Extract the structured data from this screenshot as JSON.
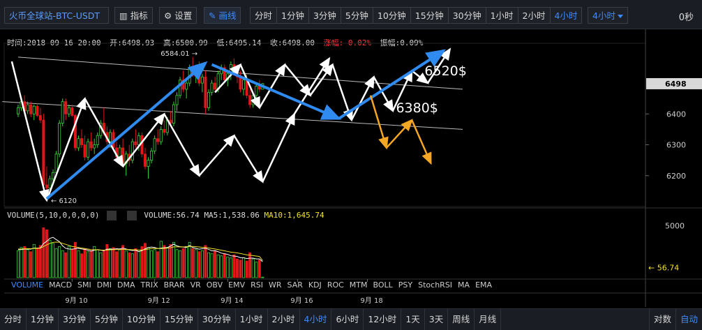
{
  "toolbar": {
    "symbol": "火币全球站-BTC-USDT",
    "indicator_label": "指标",
    "settings_label": "设置",
    "draw_label": "画线",
    "intervals": [
      "分时",
      "1分钟",
      "3分钟",
      "5分钟",
      "10分钟",
      "15分钟",
      "30分钟",
      "1小时",
      "2小时",
      "4小时"
    ],
    "selected_interval": "4小时",
    "dropdown_label": "4小时",
    "countdown": "0秒"
  },
  "ohlc": {
    "time": "时间:2018-09-16 20:00",
    "open": "开:6498.93",
    "high": "高:6500.99",
    "low": "低:6495.14",
    "close": "收:6498.00",
    "change": "涨幅:-0.02%",
    "amplitude": "振幅:0.09%"
  },
  "volume_info": {
    "params": "VOLUME(5,10,0,0,0,0)",
    "volume": "VOLUME:56.74",
    "ma5": "MA5:1,538.06",
    "ma10": "MA10:1,645.74"
  },
  "indicators": [
    "VOLUME",
    "MACD",
    "SMI",
    "DMI",
    "DMA",
    "TRIX",
    "BRAR",
    "VR",
    "OBV",
    "EMV",
    "RSI",
    "WR",
    "SAR",
    "KDJ",
    "ROC",
    "MTM",
    "BOLL",
    "PSY",
    "StochRSI",
    "MA",
    "EMA"
  ],
  "bottom": {
    "periods": [
      "分时",
      "1分钟",
      "3分钟",
      "5分钟",
      "10分钟",
      "15分钟",
      "30分钟",
      "1小时",
      "2小时",
      "4小时",
      "6小时",
      "12小时",
      "1天",
      "3天",
      "周线",
      "月线"
    ],
    "selected": "4小时",
    "log_label": "对数",
    "auto_label": "自动"
  },
  "colors": {
    "up": "#3ad23a",
    "down": "#e0161b",
    "blue_arrow": "#2f8bf0",
    "orange": "#f5a623",
    "ma10": "#f3e12a"
  },
  "chart_data": {
    "type": "candlestick",
    "price_ticks": [
      6200,
      6300,
      6400
    ],
    "current_price_label": "6498",
    "volume_tick": "5000",
    "last_volume_label": "56.74",
    "x_ticks": [
      {
        "label": "9月 10",
        "index": 17
      },
      {
        "label": "9月 12",
        "index": 43
      },
      {
        "label": "9月 14",
        "index": 66
      },
      {
        "label": "9月 16",
        "index": 88
      },
      {
        "label": "9月 18",
        "index": 110
      }
    ],
    "annotations": {
      "high_label": "6584.01",
      "low_label": "6120",
      "target_up": "6520$",
      "target_down": "6380$"
    },
    "ohlc": [
      [
        6400,
        6430,
        6390,
        6420
      ],
      [
        6420,
        6450,
        6410,
        6440
      ],
      [
        6440,
        6460,
        6400,
        6410
      ],
      [
        6410,
        6440,
        6400,
        6430
      ],
      [
        6430,
        6440,
        6390,
        6400
      ],
      [
        6400,
        6430,
        6380,
        6425
      ],
      [
        6425,
        6435,
        6390,
        6395
      ],
      [
        6395,
        6420,
        6370,
        6380
      ],
      [
        6380,
        6400,
        6150,
        6170
      ],
      [
        6170,
        6230,
        6120,
        6160
      ],
      [
        6160,
        6200,
        6130,
        6190
      ],
      [
        6190,
        6220,
        6170,
        6210
      ],
      [
        6210,
        6280,
        6200,
        6270
      ],
      [
        6270,
        6380,
        6260,
        6370
      ],
      [
        6370,
        6450,
        6360,
        6440
      ],
      [
        6440,
        6450,
        6380,
        6400
      ],
      [
        6400,
        6430,
        6390,
        6420
      ],
      [
        6420,
        6430,
        6390,
        6395
      ],
      [
        6395,
        6400,
        6280,
        6290
      ],
      [
        6290,
        6330,
        6280,
        6320
      ],
      [
        6320,
        6350,
        6290,
        6300
      ],
      [
        6300,
        6330,
        6250,
        6260
      ],
      [
        6260,
        6320,
        6250,
        6310
      ],
      [
        6310,
        6340,
        6280,
        6290
      ],
      [
        6290,
        6320,
        6270,
        6300
      ],
      [
        6300,
        6340,
        6290,
        6330
      ],
      [
        6330,
        6380,
        6320,
        6370
      ],
      [
        6370,
        6420,
        6330,
        6340
      ],
      [
        6340,
        6360,
        6300,
        6310
      ],
      [
        6310,
        6350,
        6290,
        6340
      ],
      [
        6340,
        6350,
        6280,
        6290
      ],
      [
        6290,
        6310,
        6250,
        6260
      ],
      [
        6260,
        6300,
        6240,
        6290
      ],
      [
        6290,
        6320,
        6230,
        6240
      ],
      [
        6240,
        6280,
        6200,
        6270
      ],
      [
        6270,
        6300,
        6230,
        6250
      ],
      [
        6250,
        6320,
        6240,
        6310
      ],
      [
        6310,
        6350,
        6290,
        6300
      ],
      [
        6300,
        6340,
        6280,
        6330
      ],
      [
        6330,
        6340,
        6260,
        6270
      ],
      [
        6270,
        6290,
        6220,
        6230
      ],
      [
        6230,
        6260,
        6190,
        6250
      ],
      [
        6250,
        6290,
        6240,
        6280
      ],
      [
        6280,
        6330,
        6270,
        6320
      ],
      [
        6320,
        6350,
        6300,
        6310
      ],
      [
        6310,
        6360,
        6300,
        6350
      ],
      [
        6350,
        6380,
        6330,
        6340
      ],
      [
        6340,
        6390,
        6330,
        6380
      ],
      [
        6380,
        6410,
        6360,
        6370
      ],
      [
        6370,
        6440,
        6360,
        6430
      ],
      [
        6430,
        6470,
        6410,
        6460
      ],
      [
        6460,
        6520,
        6450,
        6510
      ],
      [
        6510,
        6540,
        6470,
        6480
      ],
      [
        6480,
        6510,
        6450,
        6500
      ],
      [
        6500,
        6560,
        6490,
        6550
      ],
      [
        6550,
        6584,
        6520,
        6530
      ],
      [
        6530,
        6560,
        6500,
        6550
      ],
      [
        6550,
        6570,
        6490,
        6500
      ],
      [
        6500,
        6530,
        6470,
        6520
      ],
      [
        6520,
        6540,
        6400,
        6420
      ],
      [
        6420,
        6480,
        6410,
        6470
      ],
      [
        6470,
        6510,
        6460,
        6500
      ],
      [
        6500,
        6520,
        6470,
        6480
      ],
      [
        6480,
        6540,
        6470,
        6530
      ],
      [
        6530,
        6560,
        6510,
        6550
      ],
      [
        6550,
        6560,
        6500,
        6510
      ],
      [
        6510,
        6540,
        6490,
        6530
      ],
      [
        6530,
        6570,
        6510,
        6560
      ],
      [
        6560,
        6580,
        6530,
        6540
      ],
      [
        6540,
        6560,
        6500,
        6520
      ],
      [
        6520,
        6540,
        6470,
        6480
      ],
      [
        6480,
        6520,
        6460,
        6510
      ],
      [
        6510,
        6530,
        6450,
        6460
      ],
      [
        6460,
        6480,
        6420,
        6430
      ],
      [
        6430,
        6470,
        6420,
        6460
      ],
      [
        6460,
        6500,
        6450,
        6490
      ],
      [
        6490,
        6510,
        6470,
        6480
      ],
      [
        6480,
        6500,
        6480,
        6498
      ]
    ],
    "volume": [
      2600,
      2900,
      3000,
      2700,
      2500,
      3200,
      2800,
      3100,
      4800,
      4600,
      3600,
      3300,
      2800,
      3000,
      2600,
      2400,
      3000,
      2700,
      3400,
      2600,
      2300,
      2800,
      2500,
      2600,
      3000,
      2700,
      2400,
      2600,
      3200,
      2800,
      2900,
      2500,
      2700,
      3100,
      2600,
      2400,
      2300,
      2800,
      2500,
      3000,
      3300,
      2900,
      2600,
      2700,
      2500,
      3500,
      3100,
      2900,
      3200,
      3400,
      2700,
      2600,
      2800,
      3000,
      3400,
      2800,
      2700,
      2500,
      2600,
      3100,
      2400,
      2300,
      2600,
      2200,
      2100,
      2300,
      2000,
      1900,
      2200,
      1800,
      1700,
      1900,
      1600,
      2400,
      1800,
      1500,
      1700,
      56.74
    ],
    "vol_ma5": [
      2700,
      2700,
      2750,
      2760,
      2740,
      2850,
      2840,
      2860,
      3280,
      3500,
      3780,
      3880,
      3660,
      3460,
      3060,
      2820,
      2760,
      2740,
      2780,
      2820,
      2760,
      2720,
      2640,
      2560,
      2640,
      2700,
      2640,
      2600,
      2740,
      2740,
      2740,
      2780,
      2760,
      2840,
      2760,
      2660,
      2620,
      2640,
      2520,
      2600,
      2780,
      2900,
      2940,
      2900,
      2800,
      2840,
      2880,
      2900,
      3040,
      3220,
      3060,
      2980,
      2940,
      2900,
      3100,
      2900,
      2820,
      2740,
      2780,
      2820,
      2720,
      2580,
      2600,
      2500,
      2360,
      2300,
      2240,
      2100,
      2080,
      2040,
      1920,
      1920,
      1840,
      1880,
      1880,
      1800,
      1800,
      1538
    ],
    "vol_ma10": [
      2750,
      2760,
      2780,
      2790,
      2780,
      2820,
      2820,
      2830,
      3000,
      3150,
      3300,
      3400,
      3420,
      3400,
      3300,
      3200,
      3100,
      3000,
      2950,
      2900,
      2850,
      2800,
      2750,
      2700,
      2680,
      2680,
      2660,
      2650,
      2660,
      2680,
      2700,
      2700,
      2700,
      2720,
      2720,
      2700,
      2680,
      2680,
      2660,
      2660,
      2700,
      2750,
      2800,
      2820,
      2800,
      2800,
      2820,
      2840,
      2880,
      2960,
      2960,
      2960,
      2960,
      2960,
      3000,
      3000,
      2980,
      2950,
      2920,
      2900,
      2860,
      2800,
      2760,
      2700,
      2640,
      2580,
      2520,
      2460,
      2420,
      2380,
      2320,
      2260,
      2200,
      2160,
      2120,
      2080,
      2040,
      1645
    ],
    "trendlines": {
      "upper": {
        "from": [
          0,
          6584
        ],
        "to": [
          140,
          6480
        ]
      },
      "lower": {
        "from": [
          -5,
          6440
        ],
        "to": [
          140,
          6350
        ]
      }
    }
  }
}
